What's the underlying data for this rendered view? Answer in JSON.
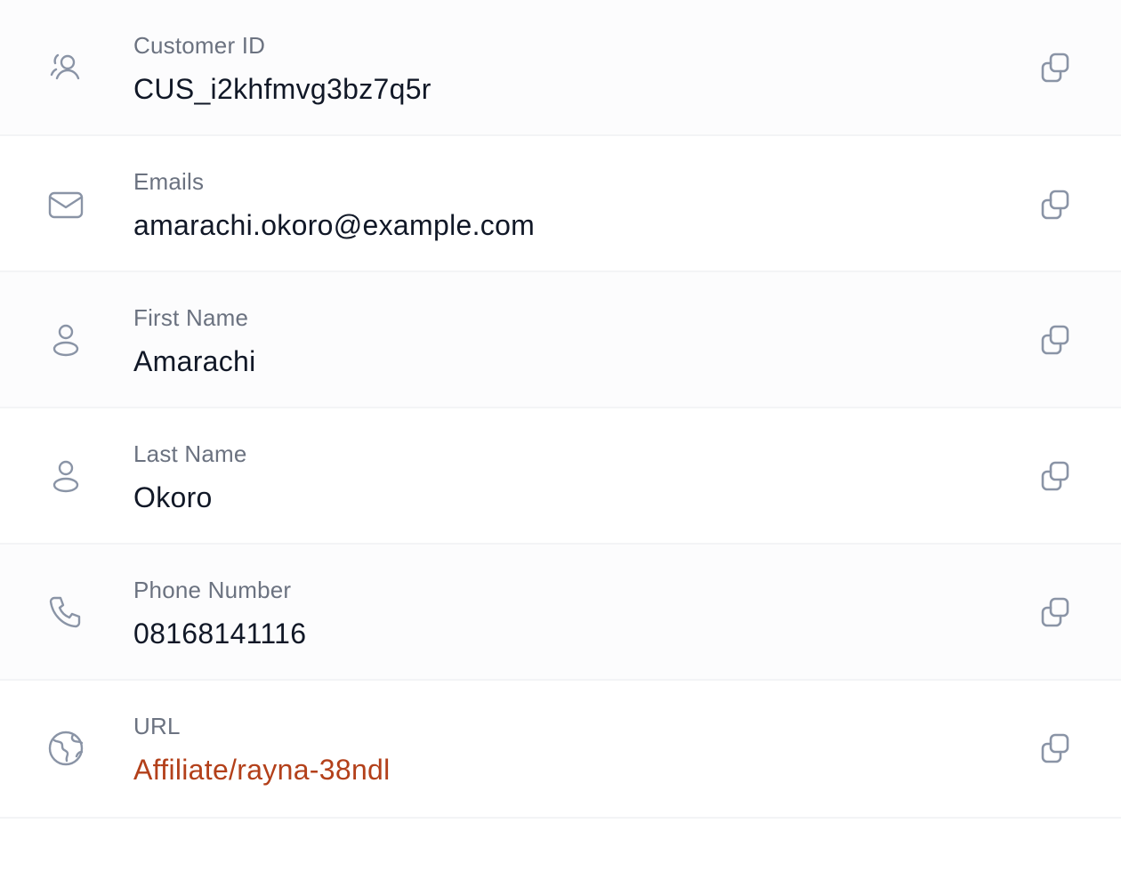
{
  "fields": [
    {
      "icon": "customer-id-icon",
      "label": "Customer ID",
      "value": "CUS_i2khfmvg3bz7q5r"
    },
    {
      "icon": "mail-icon",
      "label": "Emails",
      "value": "amarachi.okoro@example.com"
    },
    {
      "icon": "user-icon",
      "label": "First Name",
      "value": "Amarachi"
    },
    {
      "icon": "user-icon",
      "label": "Last Name",
      "value": "Okoro"
    },
    {
      "icon": "phone-icon",
      "label": "Phone Number",
      "value": "08168141116"
    },
    {
      "icon": "globe-icon",
      "label": "URL",
      "value": "Affiliate/rayna-38ndl"
    }
  ],
  "colors": {
    "label": "#6b7280",
    "value": "#111827",
    "link": "#b3401a",
    "icon": "#8a94a6",
    "divider": "#f3f4f6"
  }
}
